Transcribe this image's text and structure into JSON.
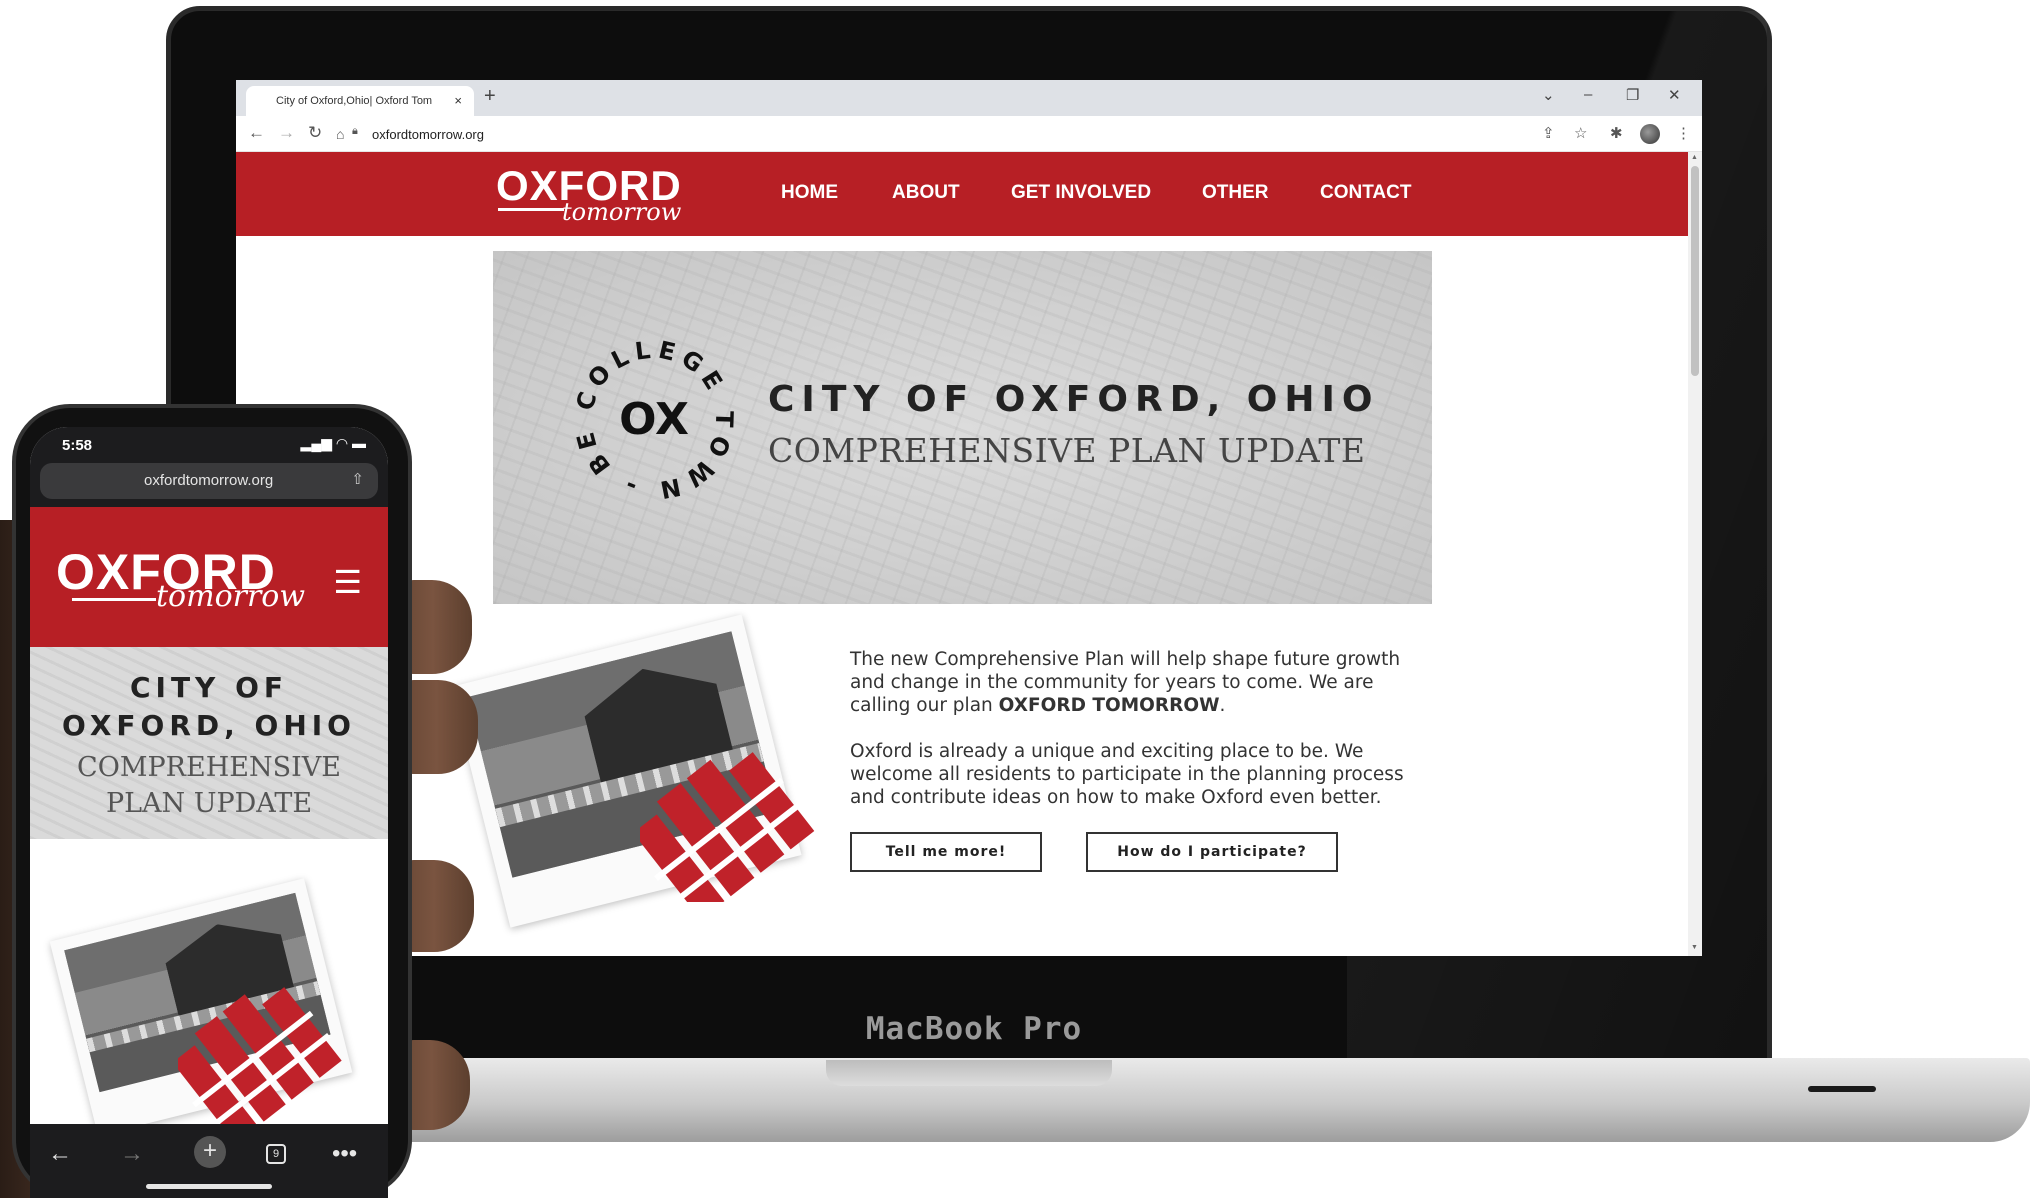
{
  "desktop": {
    "browser": {
      "tab_title": "City of Oxford,Ohio| Oxford Tom",
      "tab_close": "×",
      "new_tab": "+",
      "url": "oxfordtomorrow.org",
      "window_controls": [
        "⌄",
        "–",
        "❐",
        "✕"
      ]
    },
    "site": {
      "logo": {
        "main": "OXFORD",
        "sub": "tomorrow"
      },
      "nav": [
        "HOME",
        "ABOUT",
        "GET INVOLVED",
        "OTHER",
        "CONTACT"
      ],
      "hero": {
        "seal_ring": "COLLEGE TOWN - BEST",
        "seal_center": "OX",
        "title": "CITY OF OXFORD, OHIO",
        "subtitle": "COMPREHENSIVE PLAN UPDATE"
      },
      "para1_a": "The new Comprehensive Plan will help shape future growth and change in the community for years to come. We are calling our plan ",
      "para1_bold": "OXFORD TOMORROW",
      "para1_end": ".",
      "para2": "Oxford is already a unique and exciting place to be. We welcome all residents to participate in the planning process and contribute ideas on how to make Oxford even better.",
      "buttons": {
        "more": "Tell me more!",
        "participate": "How do I participate?"
      }
    },
    "laptop_label": "MacBook Pro"
  },
  "mobile": {
    "status_time": "5:58",
    "status_icons": "▂▄▆ ◠ ▬",
    "url": "oxfordtomorrow.org",
    "logo": {
      "main": "OXFORD",
      "sub": "tomorrow"
    },
    "menu_icon": "☰",
    "hero_title_1": "CITY OF",
    "hero_title_2": "OXFORD, OHIO",
    "hero_sub_1": "COMPREHENSIVE",
    "hero_sub_2": "PLAN UPDATE",
    "tab_count": "9"
  },
  "colors": {
    "brand_red": "#b71f25",
    "text_dark": "#333333"
  },
  "icons": [
    "back-icon",
    "forward-icon",
    "reload-icon",
    "home-icon",
    "lock-icon",
    "share-icon",
    "star-icon",
    "extensions-icon",
    "profile-icon",
    "kebab-icon",
    "hamburger-icon",
    "tabs-icon",
    "more-icon",
    "plus-icon"
  ]
}
